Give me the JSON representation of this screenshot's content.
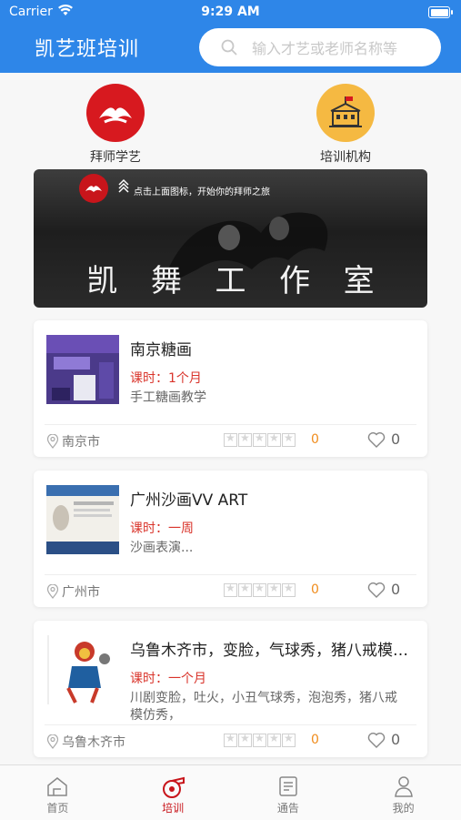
{
  "status_bar": {
    "carrier": "Carrier",
    "time": "9:29 AM"
  },
  "header": {
    "title": "凯艺班培训",
    "search_placeholder": "输入才艺或老师名称等"
  },
  "categories": [
    {
      "label": "拜师学艺",
      "icon": "dance-logo-icon",
      "color": "#d7191f"
    },
    {
      "label": "培训机构",
      "icon": "school-building-icon",
      "color": "#f5b942"
    }
  ],
  "banner": {
    "tagline": "点击上面图标，开始你的拜师之旅",
    "studio_chars": [
      "凯",
      "舞",
      "工",
      "作",
      "室"
    ]
  },
  "listings": [
    {
      "title": "南京糖画",
      "duration": "课时：1个月",
      "description": "手工糖画教学",
      "location": "南京市",
      "rating": "0",
      "likes": "0"
    },
    {
      "title": "广州沙画VV ART",
      "duration": "课时：一周",
      "description": "沙画表演...",
      "location": "广州市",
      "rating": "0",
      "likes": "0"
    },
    {
      "title": "乌鲁木齐市，变脸，气球秀，猪八戒模仿秀，",
      "duration": "课时：一个月",
      "description": "川剧变脸，吐火，小丑气球秀，泡泡秀，猪八戒模仿秀，",
      "location": "乌鲁木齐市",
      "rating": "0",
      "likes": "0"
    }
  ],
  "tabs": [
    {
      "label": "首页",
      "icon": "home-icon",
      "active": false
    },
    {
      "label": "培训",
      "icon": "whistle-icon",
      "active": true
    },
    {
      "label": "通告",
      "icon": "notice-icon",
      "active": false
    },
    {
      "label": "我的",
      "icon": "user-icon",
      "active": false
    }
  ],
  "colors": {
    "header": "#2e86e8",
    "accent_red": "#c8151b",
    "rating_orange": "#f08c1c"
  }
}
